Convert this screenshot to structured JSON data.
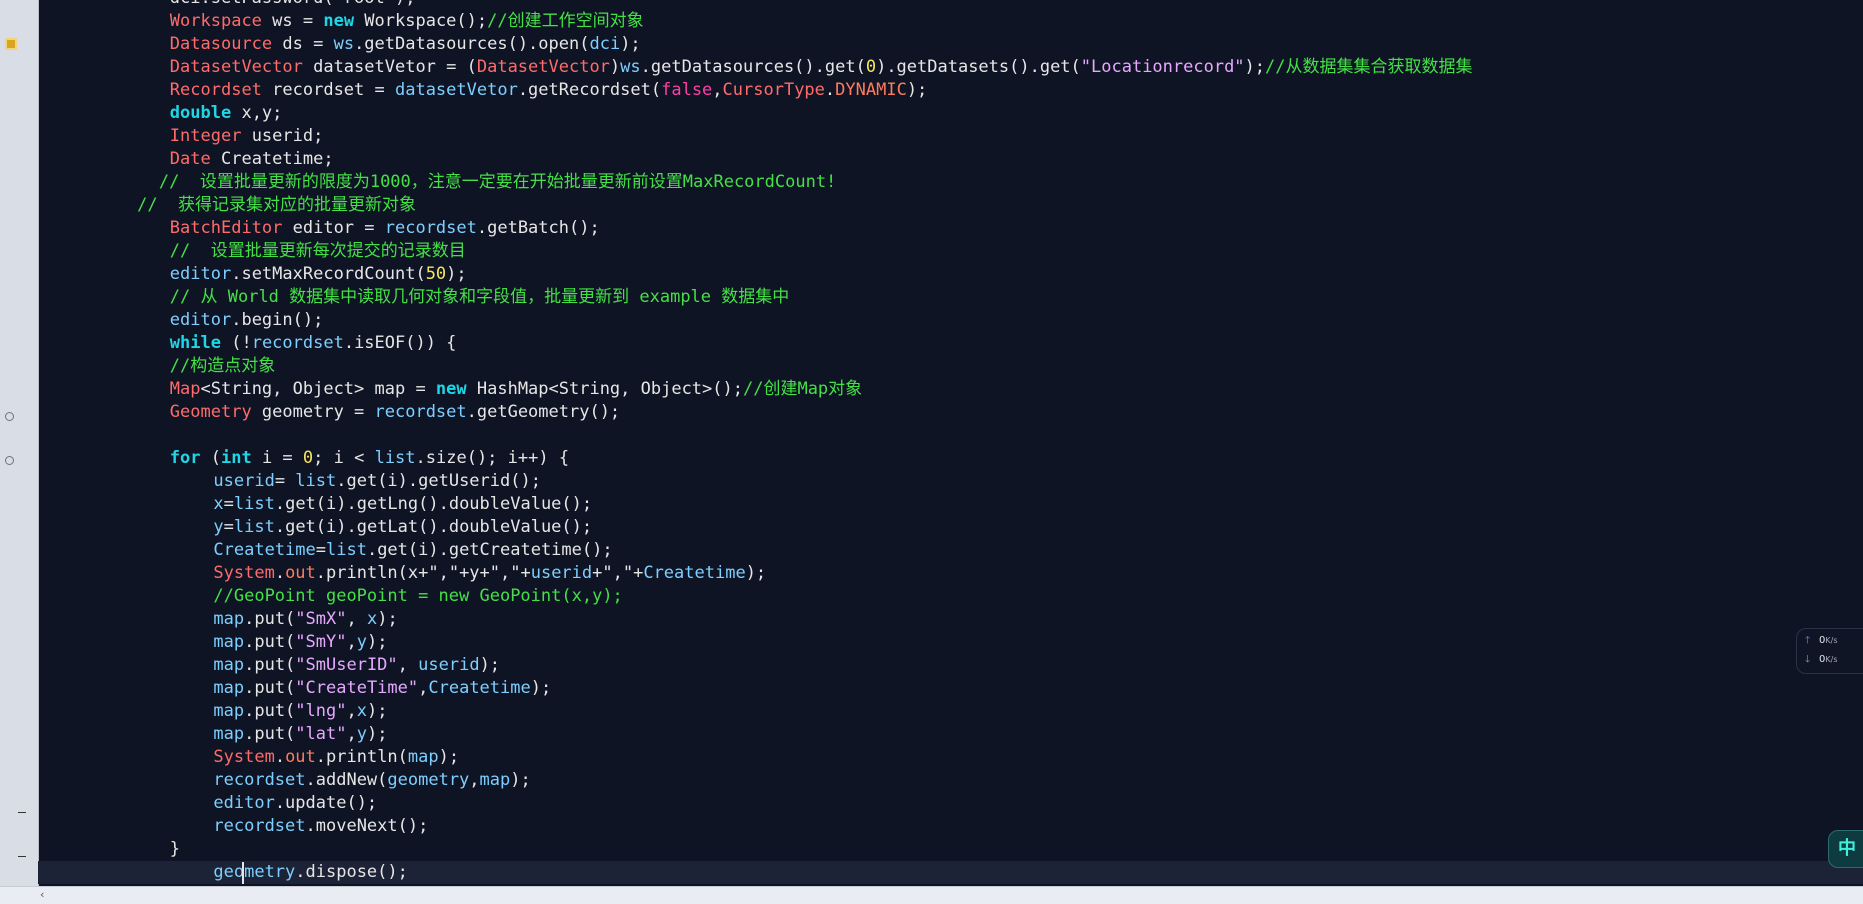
{
  "colors": {
    "background": "#0f1424",
    "keyword": "#1ed6e6",
    "comment": "#44e046",
    "type": "#ff6b6b",
    "string": "#e6a8ff",
    "number": "#f7e45a"
  },
  "code": {
    "lines": [
      {
        "indent": 12,
        "tokens": [
          {
            "c": "id",
            "t": "dci.setPassword(\"root\");"
          }
        ]
      },
      {
        "indent": 12,
        "tokens": [
          {
            "c": "ty",
            "t": "Workspace"
          },
          {
            "c": "id",
            "t": " ws = "
          },
          {
            "c": "kw",
            "t": "new"
          },
          {
            "c": "id",
            "t": " Workspace();"
          },
          {
            "c": "cm",
            "t": "//创建工作空间对象"
          }
        ]
      },
      {
        "indent": 12,
        "tokens": [
          {
            "c": "ty",
            "t": "Datasource"
          },
          {
            "c": "id",
            "t": " ds = "
          },
          {
            "c": "tb",
            "t": "ws"
          },
          {
            "c": "id",
            "t": ".getDatasources().open("
          },
          {
            "c": "tb",
            "t": "dci"
          },
          {
            "c": "id",
            "t": ");"
          }
        ]
      },
      {
        "indent": 12,
        "tokens": [
          {
            "c": "ty",
            "t": "DatasetVector"
          },
          {
            "c": "id",
            "t": " datasetVetor = ("
          },
          {
            "c": "ty",
            "t": "DatasetVector"
          },
          {
            "c": "id",
            "t": ")"
          },
          {
            "c": "tb",
            "t": "ws"
          },
          {
            "c": "id",
            "t": ".getDatasources().get("
          },
          {
            "c": "num",
            "t": "0"
          },
          {
            "c": "id",
            "t": ").getDatasets().get("
          },
          {
            "c": "str",
            "t": "\"Locationrecord\""
          },
          {
            "c": "id",
            "t": ");"
          },
          {
            "c": "cm",
            "t": "//从数据集集合获取数据集"
          }
        ]
      },
      {
        "indent": 12,
        "tokens": [
          {
            "c": "ty",
            "t": "Recordset"
          },
          {
            "c": "id",
            "t": " recordset = "
          },
          {
            "c": "tb",
            "t": "datasetVetor"
          },
          {
            "c": "id",
            "t": ".getRecordset("
          },
          {
            "c": "kwp",
            "t": "false"
          },
          {
            "c": "id",
            "t": ","
          },
          {
            "c": "ty",
            "t": "CursorType"
          },
          {
            "c": "id",
            "t": "."
          },
          {
            "c": "fld",
            "t": "DYNAMIC"
          },
          {
            "c": "id",
            "t": ");"
          }
        ]
      },
      {
        "indent": 12,
        "tokens": [
          {
            "c": "kw",
            "t": "double"
          },
          {
            "c": "id",
            "t": " x,y;"
          }
        ]
      },
      {
        "indent": 12,
        "tokens": [
          {
            "c": "ty",
            "t": "Integer"
          },
          {
            "c": "id",
            "t": " userid;"
          }
        ]
      },
      {
        "indent": 12,
        "tokens": [
          {
            "c": "ty",
            "t": "Date"
          },
          {
            "c": "id",
            "t": " Createtime;"
          }
        ]
      },
      {
        "indent": 11,
        "tokens": [
          {
            "c": "cm",
            "t": "//  设置批量更新的限度为1000，注意一定要在开始批量更新前设置MaxRecordCount!"
          }
        ]
      },
      {
        "indent": 9,
        "tokens": [
          {
            "c": "cm",
            "t": "//  获得记录集对应的批量更新对象"
          }
        ]
      },
      {
        "indent": 12,
        "tokens": [
          {
            "c": "ty",
            "t": "BatchEditor"
          },
          {
            "c": "id",
            "t": " editor = "
          },
          {
            "c": "tb",
            "t": "recordset"
          },
          {
            "c": "id",
            "t": ".getBatch();"
          }
        ]
      },
      {
        "indent": 12,
        "tokens": [
          {
            "c": "cm",
            "t": "//  设置批量更新每次提交的记录数目"
          }
        ]
      },
      {
        "indent": 12,
        "tokens": [
          {
            "c": "tb",
            "t": "editor"
          },
          {
            "c": "id",
            "t": ".setMaxRecordCount("
          },
          {
            "c": "num",
            "t": "50"
          },
          {
            "c": "id",
            "t": ");"
          }
        ]
      },
      {
        "indent": 12,
        "tokens": [
          {
            "c": "cm",
            "t": "// 从 World 数据集中读取几何对象和字段值，批量更新到 example 数据集中"
          }
        ]
      },
      {
        "indent": 12,
        "tokens": [
          {
            "c": "tb",
            "t": "editor"
          },
          {
            "c": "id",
            "t": ".begin();"
          }
        ]
      },
      {
        "indent": 12,
        "tokens": [
          {
            "c": "kw",
            "t": "while"
          },
          {
            "c": "id",
            "t": " (!"
          },
          {
            "c": "tb",
            "t": "recordset"
          },
          {
            "c": "id",
            "t": ".isEOF()) {"
          }
        ]
      },
      {
        "indent": 12,
        "tokens": [
          {
            "c": "cm",
            "t": "//构造点对象"
          }
        ]
      },
      {
        "indent": 12,
        "tokens": [
          {
            "c": "ty",
            "t": "Map"
          },
          {
            "c": "id",
            "t": "<String, Object> map = "
          },
          {
            "c": "kw",
            "t": "new"
          },
          {
            "c": "id",
            "t": " HashMap<String, Object>();"
          },
          {
            "c": "cm",
            "t": "//创建Map对象"
          }
        ]
      },
      {
        "indent": 12,
        "tokens": [
          {
            "c": "ty",
            "t": "Geometry"
          },
          {
            "c": "id",
            "t": " geometry = "
          },
          {
            "c": "tb",
            "t": "recordset"
          },
          {
            "c": "id",
            "t": ".getGeometry();"
          }
        ]
      },
      {
        "indent": 0,
        "tokens": []
      },
      {
        "indent": 12,
        "tokens": [
          {
            "c": "kw",
            "t": "for"
          },
          {
            "c": "id",
            "t": " ("
          },
          {
            "c": "kw",
            "t": "int"
          },
          {
            "c": "id",
            "t": " i = "
          },
          {
            "c": "num",
            "t": "0"
          },
          {
            "c": "id",
            "t": "; i < "
          },
          {
            "c": "tb",
            "t": "list"
          },
          {
            "c": "id",
            "t": ".size(); i++) {"
          }
        ]
      },
      {
        "indent": 16,
        "tokens": [
          {
            "c": "tb",
            "t": "userid"
          },
          {
            "c": "id",
            "t": "= "
          },
          {
            "c": "tb",
            "t": "list"
          },
          {
            "c": "id",
            "t": ".get(i).getUserid();"
          }
        ]
      },
      {
        "indent": 16,
        "tokens": [
          {
            "c": "tb",
            "t": "x"
          },
          {
            "c": "id",
            "t": "="
          },
          {
            "c": "tb",
            "t": "list"
          },
          {
            "c": "id",
            "t": ".get(i).getLng().doubleValue();"
          }
        ]
      },
      {
        "indent": 16,
        "tokens": [
          {
            "c": "tb",
            "t": "y"
          },
          {
            "c": "id",
            "t": "="
          },
          {
            "c": "tb",
            "t": "list"
          },
          {
            "c": "id",
            "t": ".get(i).getLat().doubleValue();"
          }
        ]
      },
      {
        "indent": 16,
        "tokens": [
          {
            "c": "tb",
            "t": "Createtime"
          },
          {
            "c": "id",
            "t": "="
          },
          {
            "c": "tb",
            "t": "list"
          },
          {
            "c": "id",
            "t": ".get(i).getCreatetime();"
          }
        ]
      },
      {
        "indent": 16,
        "tokens": [
          {
            "c": "ty",
            "t": "System"
          },
          {
            "c": "id",
            "t": "."
          },
          {
            "c": "fld",
            "t": "out"
          },
          {
            "c": "id",
            "t": ".println(x+\",\"+y+\",\"+"
          },
          {
            "c": "tb",
            "t": "userid"
          },
          {
            "c": "id",
            "t": "+\",\"+"
          },
          {
            "c": "tb",
            "t": "Createtime"
          },
          {
            "c": "id",
            "t": ");"
          }
        ]
      },
      {
        "indent": 16,
        "tokens": [
          {
            "c": "cm",
            "t": "//GeoPoint geoPoint = new GeoPoint(x,y);"
          }
        ]
      },
      {
        "indent": 16,
        "tokens": [
          {
            "c": "tb",
            "t": "map"
          },
          {
            "c": "id",
            "t": ".put("
          },
          {
            "c": "str",
            "t": "\"SmX\""
          },
          {
            "c": "id",
            "t": ", "
          },
          {
            "c": "tb",
            "t": "x"
          },
          {
            "c": "id",
            "t": ");"
          }
        ]
      },
      {
        "indent": 16,
        "tokens": [
          {
            "c": "tb",
            "t": "map"
          },
          {
            "c": "id",
            "t": ".put("
          },
          {
            "c": "str",
            "t": "\"SmY\""
          },
          {
            "c": "id",
            "t": ","
          },
          {
            "c": "tb",
            "t": "y"
          },
          {
            "c": "id",
            "t": ");"
          }
        ]
      },
      {
        "indent": 16,
        "tokens": [
          {
            "c": "tb",
            "t": "map"
          },
          {
            "c": "id",
            "t": ".put("
          },
          {
            "c": "str",
            "t": "\"SmUserID\""
          },
          {
            "c": "id",
            "t": ", "
          },
          {
            "c": "tb",
            "t": "userid"
          },
          {
            "c": "id",
            "t": ");"
          }
        ]
      },
      {
        "indent": 16,
        "tokens": [
          {
            "c": "tb",
            "t": "map"
          },
          {
            "c": "id",
            "t": ".put("
          },
          {
            "c": "str",
            "t": "\"CreateTime\""
          },
          {
            "c": "id",
            "t": ","
          },
          {
            "c": "tb",
            "t": "Createtime"
          },
          {
            "c": "id",
            "t": ");"
          }
        ]
      },
      {
        "indent": 16,
        "tokens": [
          {
            "c": "tb",
            "t": "map"
          },
          {
            "c": "id",
            "t": ".put("
          },
          {
            "c": "str",
            "t": "\"lng\""
          },
          {
            "c": "id",
            "t": ","
          },
          {
            "c": "tb",
            "t": "x"
          },
          {
            "c": "id",
            "t": ");"
          }
        ]
      },
      {
        "indent": 16,
        "tokens": [
          {
            "c": "tb",
            "t": "map"
          },
          {
            "c": "id",
            "t": ".put("
          },
          {
            "c": "str",
            "t": "\"lat\""
          },
          {
            "c": "id",
            "t": ","
          },
          {
            "c": "tb",
            "t": "y"
          },
          {
            "c": "id",
            "t": ");"
          }
        ]
      },
      {
        "indent": 16,
        "tokens": [
          {
            "c": "ty",
            "t": "System"
          },
          {
            "c": "id",
            "t": "."
          },
          {
            "c": "fld",
            "t": "out"
          },
          {
            "c": "id",
            "t": ".println("
          },
          {
            "c": "tb",
            "t": "map"
          },
          {
            "c": "id",
            "t": ");"
          }
        ]
      },
      {
        "indent": 16,
        "tokens": [
          {
            "c": "tb",
            "t": "recordset"
          },
          {
            "c": "id",
            "t": ".addNew("
          },
          {
            "c": "tb",
            "t": "geometry"
          },
          {
            "c": "id",
            "t": ","
          },
          {
            "c": "tb",
            "t": "map"
          },
          {
            "c": "id",
            "t": ");"
          }
        ]
      },
      {
        "indent": 16,
        "tokens": [
          {
            "c": "tb",
            "t": "editor"
          },
          {
            "c": "id",
            "t": ".update();"
          }
        ]
      },
      {
        "indent": 16,
        "tokens": [
          {
            "c": "tb",
            "t": "recordset"
          },
          {
            "c": "id",
            "t": ".moveNext();"
          }
        ]
      },
      {
        "indent": 12,
        "tokens": [
          {
            "c": "id",
            "t": "}"
          }
        ]
      },
      {
        "indent": 16,
        "current": true,
        "tokens": [
          {
            "c": "tb",
            "t": "geometry"
          },
          {
            "c": "id",
            "t": ".dispose();"
          }
        ]
      }
    ]
  },
  "status_bar": {
    "scroll_left_icon": "chevron-left-icon",
    "scroll_left_glyph": "‹"
  },
  "netspeed": {
    "upload": "0",
    "upload_unit": "K/s",
    "download": "0",
    "download_unit": "K/s"
  },
  "ime": {
    "label": "中"
  }
}
